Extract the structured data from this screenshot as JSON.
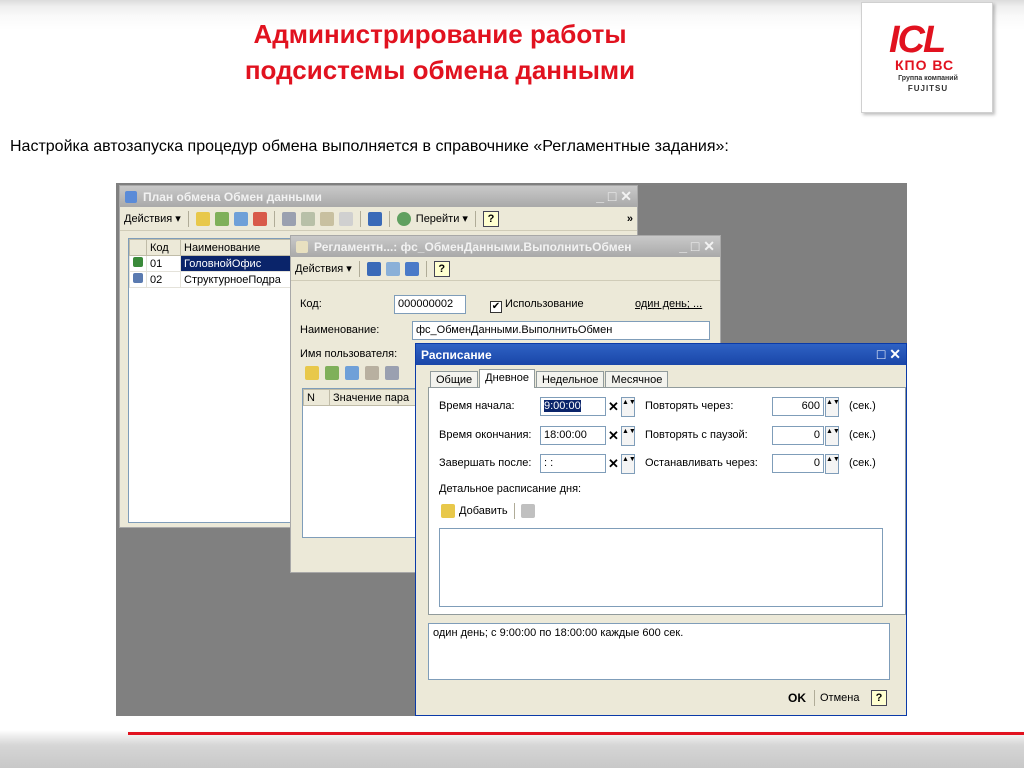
{
  "slide": {
    "title_line1": "Администрирование работы",
    "title_line2": "подсистемы обмена данными",
    "subtitle": "Настройка автозапуска процедур обмена выполняется в справочнике «Регламентные задания»:",
    "accent_color": "#e1121f"
  },
  "logo": {
    "brand": "ICL",
    "line2": "КПО ВС",
    "line3": "Группа компаний",
    "line4": "FUJITSU"
  },
  "win1": {
    "title": "План обмена Обмен данными",
    "controls": "_ □ ✕",
    "actions_label": "Действия ▾",
    "goto_label": "Перейти ▾",
    "more": "»",
    "help": "?",
    "columns": [
      "Код",
      "Наименование"
    ],
    "rows": [
      {
        "code": "01",
        "name": "ГоловнойОфис"
      },
      {
        "code": "02",
        "name": "СтруктурноеПодра"
      }
    ]
  },
  "win2": {
    "title": "Регламентн...: фс_ОбменДанными.ВыполнитьОбмен",
    "controls": "_ □ ✕",
    "actions_label": "Действия ▾",
    "help": "?",
    "code_label": "Код:",
    "code_value": "000000002",
    "use_label": "Использование",
    "use_checked": "✔",
    "schedule_link": "один день; ...",
    "name_label": "Наименование:",
    "name_value": "фс_ОбменДанными.ВыполнитьОбмен",
    "user_label": "Имя пользователя:",
    "params_columns": [
      "N",
      "Значение пара"
    ]
  },
  "win3": {
    "title": "Расписание",
    "controls": "□ ✕",
    "tabs": [
      "Общие",
      "Дневное",
      "Недельное",
      "Месячное"
    ],
    "start_label": "Время начала:",
    "start_value": "9:00:00",
    "end_label": "Время окончания:",
    "end_value": "18:00:00",
    "finish_label": "Завершать после:",
    "finish_value": " :  : ",
    "repeat_label": "Повторять через:",
    "repeat_value": "600",
    "pause_label": "Повторять с паузой:",
    "pause_value": "0",
    "stop_label": "Останавливать через:",
    "stop_value": "0",
    "sec_unit": "(сек.)",
    "detail_label": "Детальное расписание дня:",
    "add_label": "Добавить",
    "summary": "один день; с 9:00:00 по 18:00:00 каждые 600 сек.",
    "ok_label": "OK",
    "cancel_label": "Отмена",
    "help": "?",
    "clear_glyph": "✕",
    "spin_glyph": "▲▼"
  }
}
